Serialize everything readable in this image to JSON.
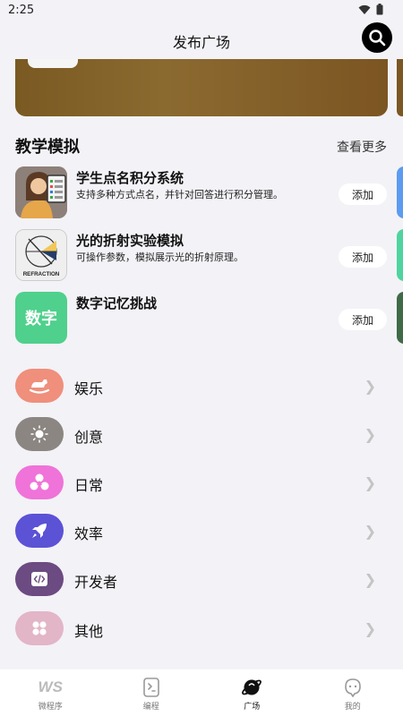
{
  "status": {
    "time": "2:25"
  },
  "header": {
    "title": "发布广场"
  },
  "section": {
    "title": "教学模拟",
    "see_more": "查看更多"
  },
  "apps": [
    {
      "name": "学生点名积分系统",
      "desc": "支持多种方式点名，并针对回答进行积分管理。",
      "add": "添加"
    },
    {
      "name": "光的折射实验模拟",
      "desc": "可操作参数，模拟展示光的折射原理。",
      "add": "添加",
      "icon_text": "REFRACTION"
    },
    {
      "name": "数字记忆挑战",
      "desc": "",
      "add": "添加",
      "icon_text": "数字"
    }
  ],
  "categories": [
    {
      "label": "娱乐",
      "color": "#ef8f7c",
      "icon": "rocking-horse-icon"
    },
    {
      "label": "创意",
      "color": "#8b8682",
      "icon": "lightbulb-icon"
    },
    {
      "label": "日常",
      "color": "#ef73d8",
      "icon": "triangle-circles-icon"
    },
    {
      "label": "效率",
      "color": "#5b52d6",
      "icon": "rocket-icon"
    },
    {
      "label": "开发者",
      "color": "#6c4a82",
      "icon": "code-icon"
    },
    {
      "label": "其他",
      "color": "#e2b5c7",
      "icon": "grid-icon"
    }
  ],
  "tabs": [
    {
      "label": "微程序",
      "icon": "ws-logo-icon",
      "active": false
    },
    {
      "label": "编程",
      "icon": "code-file-icon",
      "active": false
    },
    {
      "label": "广场",
      "icon": "planet-icon",
      "active": true
    },
    {
      "label": "我的",
      "icon": "profile-face-icon",
      "active": false
    }
  ],
  "tab_logo_text": "WS"
}
